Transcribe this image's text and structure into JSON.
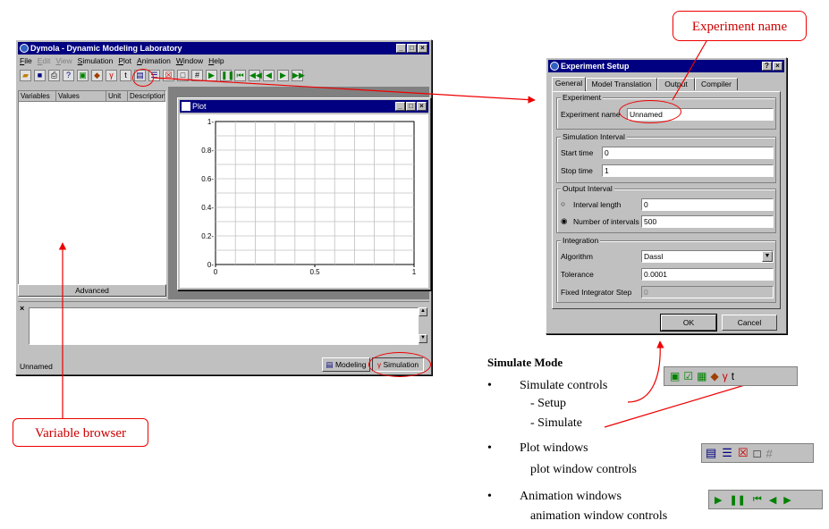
{
  "main_window": {
    "title": "Dymola - Dynamic Modeling Laboratory",
    "menu": [
      "File",
      "Edit",
      "View",
      "Simulation",
      "Plot",
      "Animation",
      "Window",
      "Help"
    ],
    "variable_browser": {
      "columns": [
        "Variables",
        "Values",
        "Unit",
        "Description"
      ],
      "advanced_button": "Advanced"
    },
    "status_text": "Unnamed",
    "mode_buttons": {
      "modeling": "Modeling",
      "simulation": "Simulation"
    }
  },
  "plot_window": {
    "title": "Plot",
    "chart_data": {
      "type": "line",
      "x": [],
      "series": [],
      "xlim": [
        0,
        1
      ],
      "ylim": [
        0,
        1
      ],
      "xticks": [
        "0",
        "0.5",
        "1"
      ],
      "yticks": [
        "0-",
        "0.2-",
        "0.4-",
        "0.6-",
        "0.8-",
        "1-"
      ],
      "grid": true
    }
  },
  "experiment_setup": {
    "title": "Experiment Setup",
    "tabs": [
      "General",
      "Model Translation",
      "Output",
      "Compiler"
    ],
    "experiment_group": "Experiment",
    "experiment_name_label": "Experiment name",
    "experiment_name_value": "Unnamed",
    "sim_interval_group": "Simulation Interval",
    "start_time_label": "Start time",
    "start_time_value": "0",
    "stop_time_label": "Stop time",
    "stop_time_value": "1",
    "output_interval_group": "Output Interval",
    "interval_length_label": "Interval length",
    "interval_length_value": "0",
    "num_intervals_label": "Number of intervals",
    "num_intervals_value": "500",
    "integration_group": "Integration",
    "algorithm_label": "Algorithm",
    "algorithm_value": "Dassl",
    "tolerance_label": "Tolerance",
    "tolerance_value": "0.0001",
    "fixed_step_label": "Fixed Integrator Step",
    "fixed_step_value": "0",
    "ok_label": "OK",
    "cancel_label": "Cancel"
  },
  "annotations": {
    "experiment_name_callout": "Experiment name",
    "variable_browser_callout": "Variable browser",
    "simulate_mode_heading": "Simulate Mode",
    "bullet1": "Simulate controls",
    "bullet1_sub1": "- Setup",
    "bullet1_sub2": "- Simulate",
    "bullet2": "Plot windows",
    "bullet2_sub": "plot window controls",
    "bullet3": "Animation windows",
    "bullet3_sub": "animation window controls"
  },
  "colors": {
    "titlebar": "#000080",
    "annotation_red": "#e00000",
    "window_bg": "#c0c0c0"
  }
}
